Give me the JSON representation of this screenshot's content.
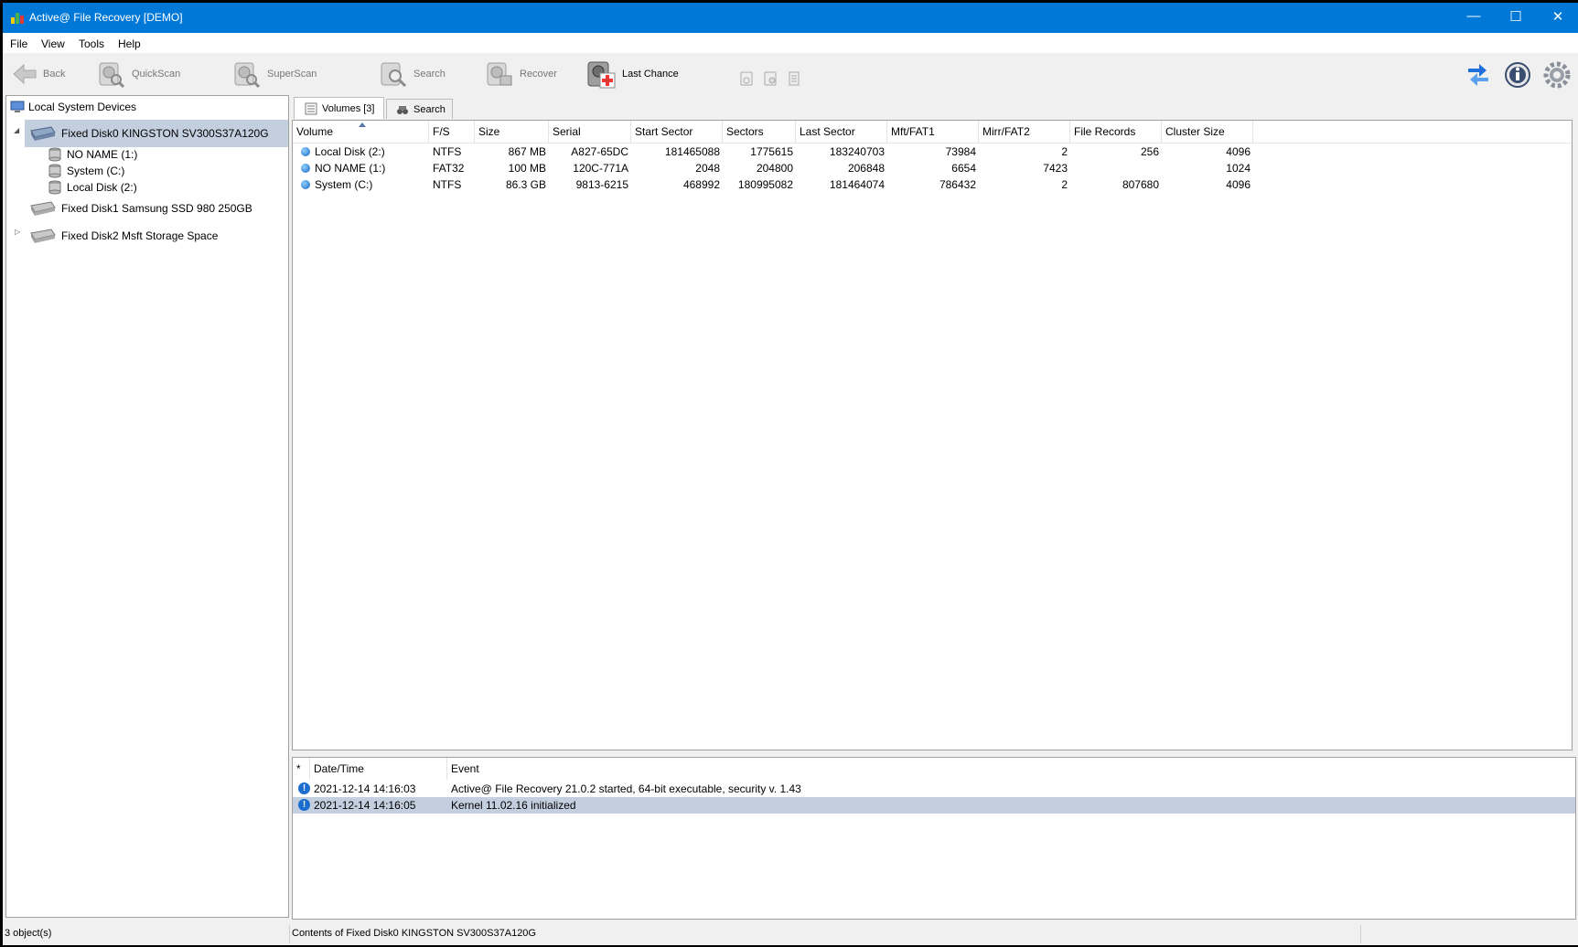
{
  "window": {
    "title": "Active@ File Recovery [DEMO]",
    "min": "—",
    "max": "☐",
    "close": "✕"
  },
  "menu": [
    "File",
    "View",
    "Tools",
    "Help"
  ],
  "toolbar": {
    "back": "Back",
    "quickscan": "QuickScan",
    "superscan": "SuperScan",
    "search": "Search",
    "recover": "Recover",
    "lastchance": "Last Chance"
  },
  "tree": {
    "root": "Local System Devices",
    "disk0": "Fixed Disk0 KINGSTON SV300S37A120G",
    "vol1": "NO NAME (1:)",
    "vol2": "System (C:)",
    "vol3": "Local Disk (2:)",
    "disk1": "Fixed Disk1 Samsung SSD 980 250GB",
    "disk2": "Fixed Disk2 Msft Storage Space"
  },
  "tabs": {
    "volumes": "Volumes [3]",
    "search": "Search"
  },
  "volumes": {
    "headers": [
      "Volume",
      "F/S",
      "Size",
      "Serial",
      "Start Sector",
      "Sectors",
      "Last Sector",
      "Mft/FAT1",
      "Mirr/FAT2",
      "File Records",
      "Cluster Size"
    ],
    "rows": [
      [
        "Local Disk (2:)",
        "NTFS",
        "867 MB",
        "A827-65DC",
        "181465088",
        "1775615",
        "183240703",
        "73984",
        "2",
        "256",
        "4096"
      ],
      [
        "NO NAME (1:)",
        "FAT32",
        "100 MB",
        "120C-771A",
        "2048",
        "204800",
        "206848",
        "6654",
        "7423",
        "",
        "1024"
      ],
      [
        "System (C:)",
        "NTFS",
        "86.3 GB",
        "9813-6215",
        "468992",
        "180995082",
        "181464074",
        "786432",
        "2",
        "807680",
        "4096"
      ]
    ]
  },
  "log": {
    "headers": [
      "*",
      "Date/Time",
      "Event"
    ],
    "rows": [
      [
        "2021-12-14 14:16:03",
        "Active@ File Recovery 21.0.2 started, 64-bit executable, security v. 1.43"
      ],
      [
        "2021-12-14 14:16:05",
        "Kernel 11.02.16 initialized"
      ]
    ]
  },
  "status": {
    "left": "3 object(s)",
    "center": "Contents of Fixed Disk0 KINGSTON SV300S37A120G"
  }
}
